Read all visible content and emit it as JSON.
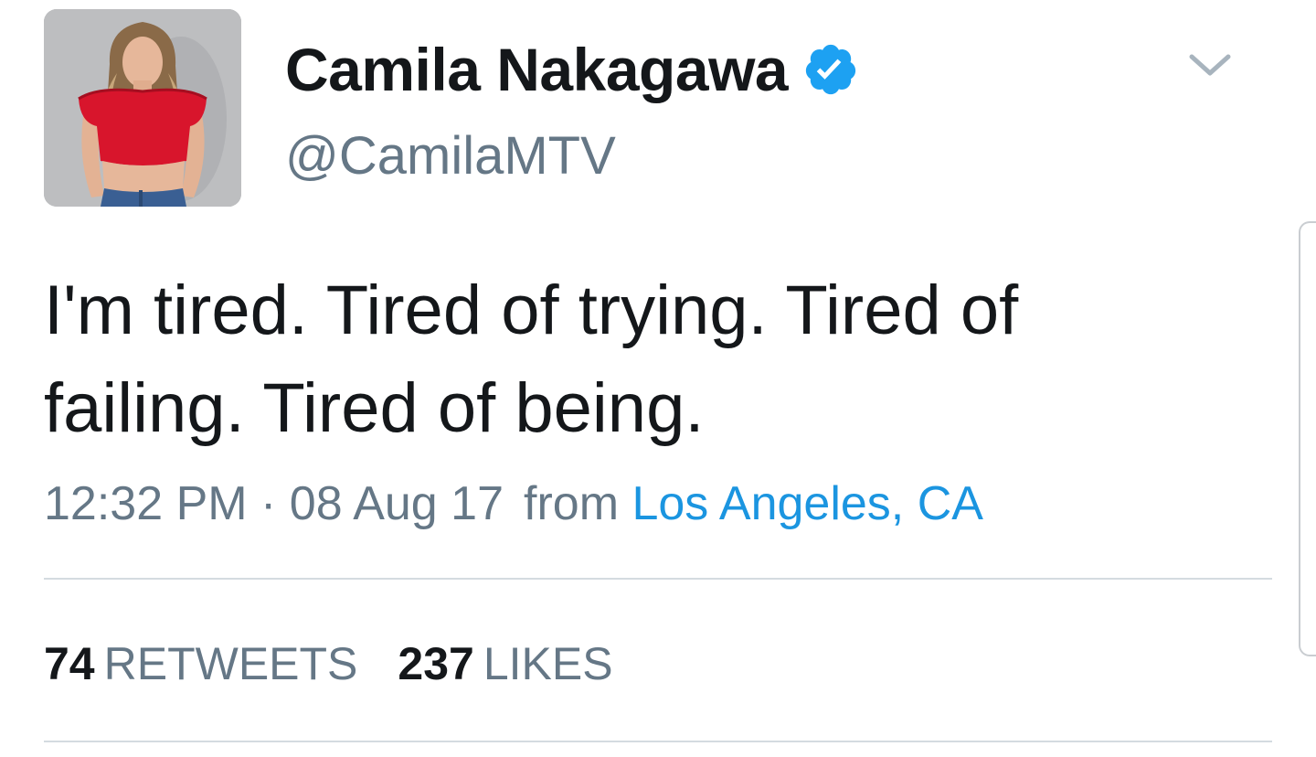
{
  "tweet": {
    "author": {
      "display_name": "Camila Nakagawa",
      "handle": "@CamilaMTV",
      "verified": true,
      "avatar_icon": "profile-photo"
    },
    "text": "I'm tired. Tired of trying. Tired of failing. Tired of being.",
    "timestamp": "12:32 PM · 08 Aug 17",
    "from_label": "from",
    "location": "Los Angeles, CA",
    "stats": {
      "retweets_count": "74",
      "retweets_label": "RETWEETS",
      "likes_count": "237",
      "likes_label": "LIKES"
    },
    "menu_icon": "chevron-down-icon"
  },
  "colors": {
    "verified_blue": "#1da1f2",
    "link_blue": "#1b95e0",
    "secondary_text": "#657786",
    "primary_text": "#14171a",
    "divider": "#d4dbe0"
  }
}
